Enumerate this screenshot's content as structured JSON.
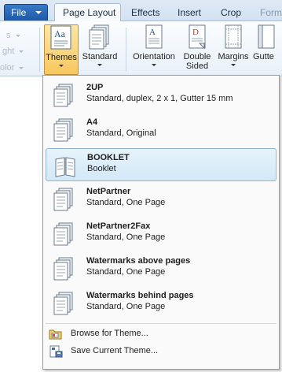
{
  "tabs": {
    "file": "File",
    "page_layout": "Page Layout",
    "effects": "Effects",
    "insert": "Insert",
    "crop": "Crop",
    "format": "Form"
  },
  "ribbon": {
    "left_fragments": [
      "s",
      "ght",
      "olor"
    ],
    "themes": "Themes",
    "standard": "Standard",
    "orientation": "Orientation",
    "double_sided_1": "Double",
    "double_sided_2": "Sided",
    "margins": "Margins",
    "gutter": "Gutte"
  },
  "menu": {
    "items": [
      {
        "title": "2UP",
        "desc": "Standard, duplex, 2 x 1, Gutter 15 mm",
        "icon": "page-stack-icon"
      },
      {
        "title": "A4",
        "desc": "Standard, Original",
        "icon": "page-stack-icon"
      },
      {
        "title": "BOOKLET",
        "desc": "Booklet",
        "icon": "booklet-icon",
        "selected": true
      },
      {
        "title": "NetPartner",
        "desc": "Standard, One Page",
        "icon": "page-stack-icon"
      },
      {
        "title": "NetPartner2Fax",
        "desc": "Standard, One Page",
        "icon": "page-stack-icon"
      },
      {
        "title": "Watermarks above pages",
        "desc": "Standard, One Page",
        "icon": "page-stack-icon"
      },
      {
        "title": "Watermarks behind pages",
        "desc": "Standard, One Page",
        "icon": "page-stack-icon"
      }
    ],
    "browse": "Browse for Theme...",
    "save": "Save Current Theme..."
  },
  "colors": {
    "file_tab": "#1d5aa8",
    "pressed_button": "#f8c75f",
    "selected_item": "#d3e8f7"
  }
}
